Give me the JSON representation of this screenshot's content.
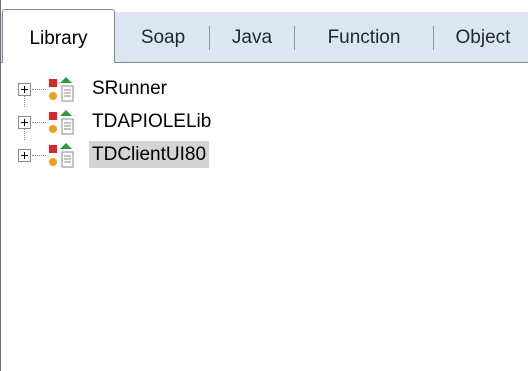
{
  "tabs": [
    {
      "label": "Library",
      "active": true
    },
    {
      "label": "Soap",
      "active": false
    },
    {
      "label": "Java",
      "active": false
    },
    {
      "label": "Function",
      "active": false
    },
    {
      "label": "Object",
      "active": false
    }
  ],
  "tree": {
    "nodes": [
      {
        "label": "SRunner",
        "icon": "library-icon",
        "expanded": false,
        "selected": false
      },
      {
        "label": "TDAPIOLELib",
        "icon": "library-icon",
        "expanded": false,
        "selected": false
      },
      {
        "label": "TDClientUI80",
        "icon": "library-icon",
        "expanded": false,
        "selected": true
      }
    ]
  },
  "colors": {
    "tabbar_bg": "#dde6f0",
    "selection_bg": "#d4d4d4",
    "icon_red": "#d8282a",
    "icon_green": "#2e9a38",
    "icon_orange": "#f0a020"
  }
}
